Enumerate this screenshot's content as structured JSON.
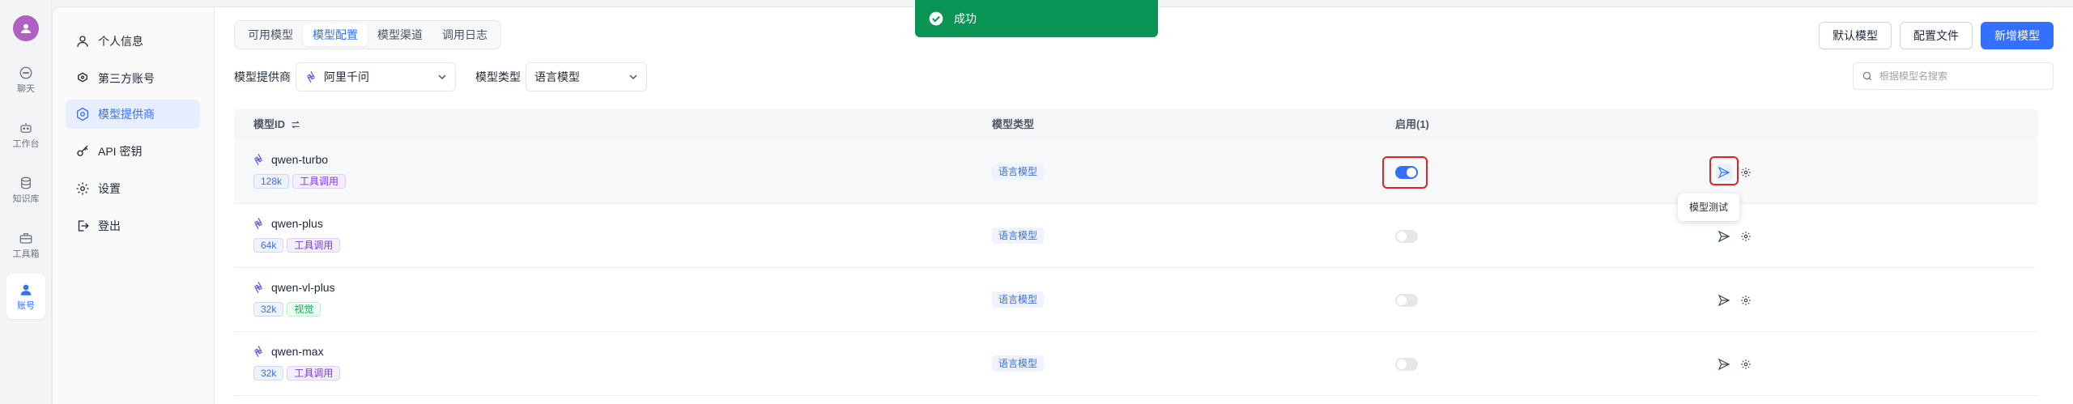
{
  "rail": {
    "items": [
      {
        "label": "聊天",
        "icon": "chat-icon"
      },
      {
        "label": "工作台",
        "icon": "robot-icon"
      },
      {
        "label": "知识库",
        "icon": "database-icon"
      },
      {
        "label": "工具箱",
        "icon": "toolbox-icon"
      },
      {
        "label": "账号",
        "icon": "user-icon",
        "active": true
      }
    ]
  },
  "side": {
    "items": [
      {
        "label": "个人信息",
        "icon": "user-icon"
      },
      {
        "label": "第三方账号",
        "icon": "link-icon"
      },
      {
        "label": "模型提供商",
        "icon": "model-icon",
        "active": true
      },
      {
        "label": "API 密钥",
        "icon": "key-icon"
      },
      {
        "label": "设置",
        "icon": "gear-icon"
      },
      {
        "label": "登出",
        "icon": "logout-icon"
      }
    ]
  },
  "tabs": [
    "可用模型",
    "模型配置",
    "模型渠道",
    "调用日志"
  ],
  "active_tab": "模型配置",
  "filters": {
    "provider_label": "模型提供商",
    "provider_value": "阿里千问",
    "type_label": "模型类型",
    "type_value": "语言模型"
  },
  "buttons": {
    "default_model": "默认模型",
    "config_file": "配置文件",
    "new_model": "新增模型"
  },
  "search": {
    "placeholder": "根据模型名搜索"
  },
  "table": {
    "col_model_id": "模型ID",
    "col_type": "模型类型",
    "col_enabled": "启用(1)",
    "rows": [
      {
        "name": "qwen-turbo",
        "tags": [
          {
            "text": "128k",
            "color": "blue"
          },
          {
            "text": "工具调用",
            "color": "purple"
          }
        ],
        "type": "语言模型",
        "enabled": true
      },
      {
        "name": "qwen-plus",
        "tags": [
          {
            "text": "64k",
            "color": "blue"
          },
          {
            "text": "工具调用",
            "color": "purple"
          }
        ],
        "type": "语言模型",
        "enabled": false
      },
      {
        "name": "qwen-vl-plus",
        "tags": [
          {
            "text": "32k",
            "color": "blue"
          },
          {
            "text": "视觉",
            "color": "green"
          }
        ],
        "type": "语言模型",
        "enabled": false
      },
      {
        "name": "qwen-max",
        "tags": [
          {
            "text": "32k",
            "color": "blue"
          },
          {
            "text": "工具调用",
            "color": "purple"
          }
        ],
        "type": "语言模型",
        "enabled": false
      }
    ]
  },
  "tooltip": "模型测试",
  "toast": {
    "text": "成功"
  },
  "colors": {
    "accent": "#3370ff",
    "success": "#079455",
    "highlight": "#e02424"
  }
}
